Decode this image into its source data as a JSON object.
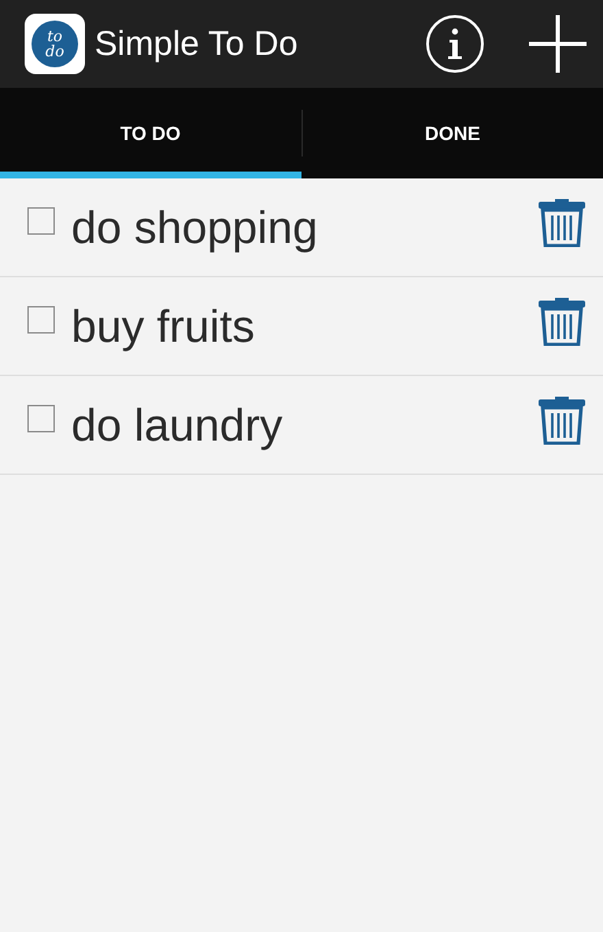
{
  "app_bar": {
    "logo_lines": [
      "to",
      "do"
    ],
    "title": "Simple To Do"
  },
  "tabs": [
    {
      "label": "TO DO",
      "selected": true
    },
    {
      "label": "DONE",
      "selected": false
    }
  ],
  "tasks": [
    {
      "text": "do shopping",
      "checked": false
    },
    {
      "text": "buy fruits",
      "checked": false
    },
    {
      "text": "do laundry",
      "checked": false
    }
  ]
}
